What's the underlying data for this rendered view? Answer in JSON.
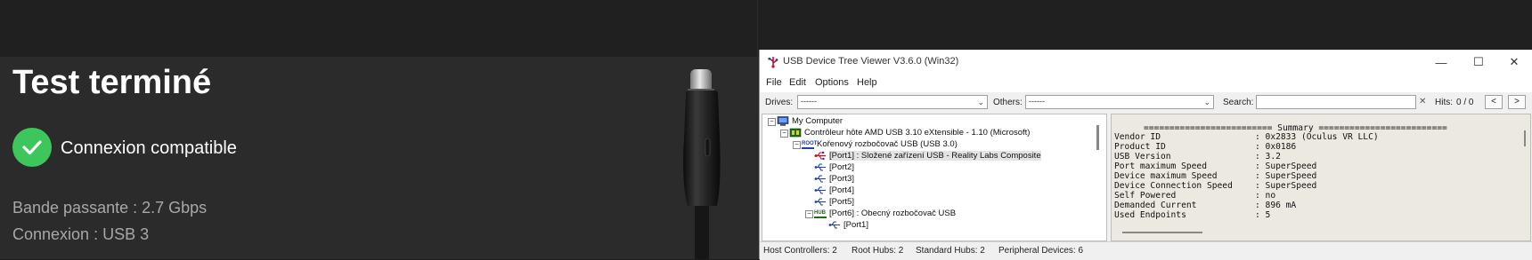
{
  "left": {
    "title": "Test terminé",
    "compat": "Connexion compatible",
    "bandwidth": "Bande passante : 2.7 Gbps",
    "connection": "Connexion : USB 3",
    "check_color": "#3cc65c"
  },
  "window": {
    "title": "USB Device Tree Viewer V3.6.0  (Win32)",
    "controls": {
      "minimize": "—",
      "maximize": "☐",
      "close": "✕"
    }
  },
  "menu": [
    "File",
    "Edit",
    "Options",
    "Help"
  ],
  "toolbar": {
    "drives_label": "Drives:",
    "drives_value": "------",
    "others_label": "Others:",
    "others_value": "------",
    "search_label": "Search:",
    "search_value": "",
    "hits_label": "Hits:",
    "hits_value": "0 / 0",
    "prev": "<",
    "next": ">"
  },
  "tree": [
    {
      "label": "My Computer",
      "icon": "computer-icon",
      "expander": "−"
    },
    {
      "label": "Contrôleur hôte AMD USB 3.10 eXtensible - 1.10 (Microsoft)",
      "icon": "host-controller-icon",
      "expander": "−"
    },
    {
      "label": "Kořenový rozbočovač USB (USB 3.0)",
      "icon": "root-hub-icon",
      "icon_text": "ROOT",
      "expander": "−"
    },
    {
      "label": "[Port1] : Složené zařízení USB - Reality Labs Composite",
      "icon": "usb-device-icon",
      "selected": true
    },
    {
      "label": "[Port2]",
      "icon": "usb-port-icon"
    },
    {
      "label": "[Port3]",
      "icon": "usb-port-icon"
    },
    {
      "label": "[Port4]",
      "icon": "usb-port-icon"
    },
    {
      "label": "[Port5]",
      "icon": "usb-port-icon"
    },
    {
      "label": "[Port6] : Obecný rozbočovač USB",
      "icon": "hub-icon",
      "icon_text": "HUB",
      "expander": "−"
    },
    {
      "label": "[Port1]",
      "icon": "usb-port-icon"
    }
  ],
  "summary_header": "========================= Summary =========================",
  "summary": [
    {
      "key": "Vendor ID",
      "value": ": 0x2833 (Oculus VR LLC)"
    },
    {
      "key": "Product ID",
      "value": ": 0x0186"
    },
    {
      "key": "USB Version",
      "value": ": 3.2"
    },
    {
      "key": "Port maximum Speed",
      "value": ": SuperSpeed"
    },
    {
      "key": "Device maximum Speed",
      "value": ": SuperSpeed"
    },
    {
      "key": "Device Connection Speed",
      "value": ": SuperSpeed"
    },
    {
      "key": "Self Powered",
      "value": ": no"
    },
    {
      "key": "Demanded Current",
      "value": ": 896 mA"
    },
    {
      "key": "Used Endpoints",
      "value": ": 5"
    }
  ],
  "status": {
    "host_controllers": "Host Controllers: 2",
    "root_hubs": "Root Hubs: 2",
    "standard_hubs": "Standard Hubs: 2",
    "peripheral_devices": "Peripheral Devices: 6"
  }
}
